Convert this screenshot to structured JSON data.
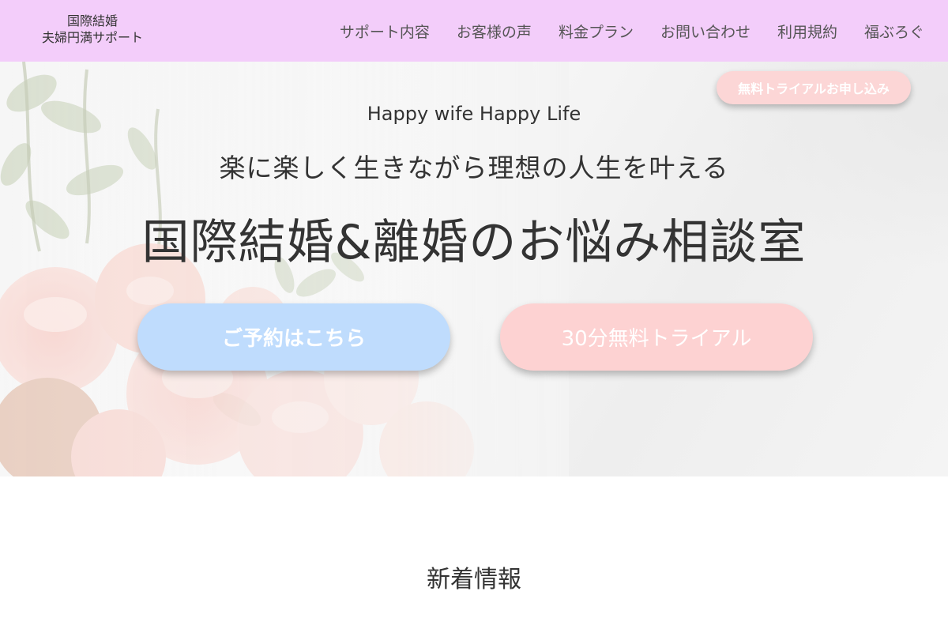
{
  "header": {
    "logo_line1": "国際結婚",
    "logo_line2": "夫婦円満サポート",
    "nav": [
      {
        "label": "サポート内容"
      },
      {
        "label": "お客様の声"
      },
      {
        "label": "料金プラン"
      },
      {
        "label": "お問い合わせ"
      },
      {
        "label": "利用規約"
      },
      {
        "label": "福ぶろぐ"
      }
    ]
  },
  "hero": {
    "trial_pill_label": "無料トライアルお申し込み",
    "tagline": "Happy wife Happy Life",
    "subtitle": "楽に楽しく生きながら理想の人生を叶える",
    "title": "国際結婚&離婚のお悩み相談室",
    "reserve_button": "ご予約はこちら",
    "trial_button": "30分無料トライアル"
  },
  "news": {
    "heading": "新着情報"
  },
  "colors": {
    "header_bg": "#f3cdfa",
    "reserve_button": "#bfdcfd",
    "trial_button": "#fdd2d2",
    "text": "#333333"
  }
}
